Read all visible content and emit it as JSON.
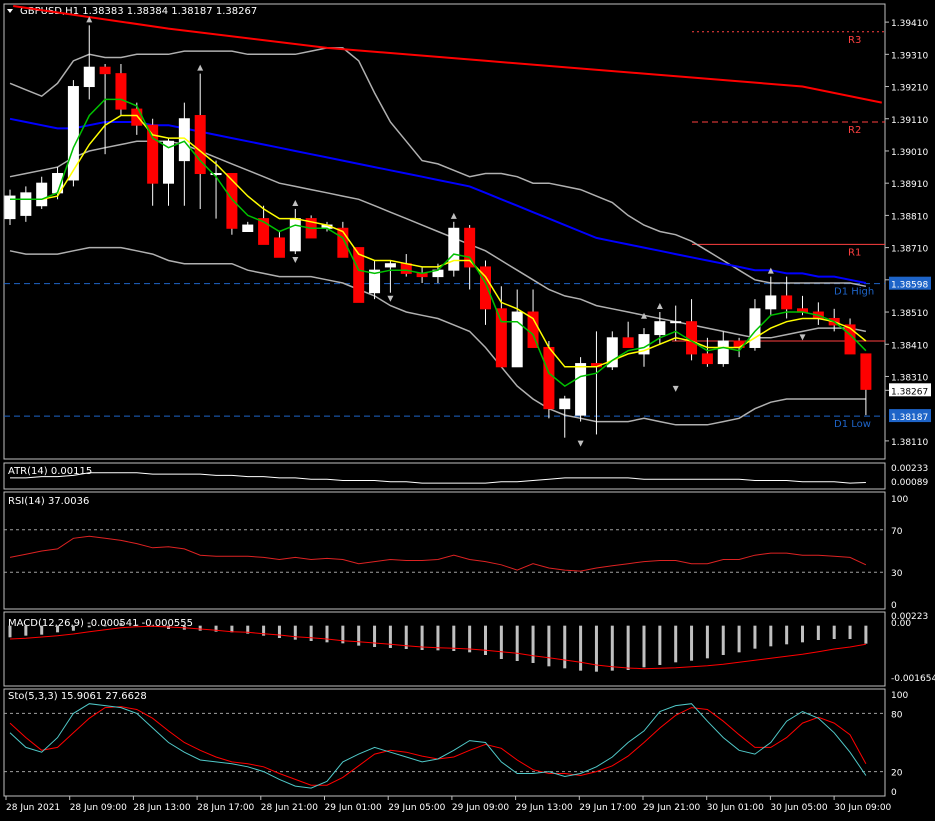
{
  "colors": {
    "background": "#000000",
    "bull_body": "#ffffff",
    "bear_body": "#ff0000",
    "wick": "#ffffff",
    "grid": "#808080",
    "bands": "#b0b0b0",
    "ma_fast": "#00c000",
    "ma_slow": "#ffff00",
    "ma_blue": "#0000ff",
    "ma_red": "#ff0000",
    "pivot": "#ff4040",
    "day_levels": "#1e64c8",
    "price_label_bg": "#1e64c8",
    "macd_hist": "#c0c0c0",
    "macd_signal": "#ff0000",
    "rsi_line": "#dd2222",
    "sto_main": "#50c8c8",
    "sto_signal": "#ff0000"
  },
  "chart_data": [
    {
      "type": "candlestick",
      "title": "GBPUSD,H1  1.38383 1.38384 1.38187 1.38267",
      "symbol": "GBPUSD",
      "timeframe": "H1",
      "ohlc_header": "1.38383 1.38384 1.38187 1.38267",
      "last_price_label": "1.38267",
      "ylim": [
        1.3806,
        1.3946
      ],
      "yticks": [
        "1.39410",
        "1.39310",
        "1.39210",
        "1.39110",
        "1.39010",
        "1.38910",
        "1.38810",
        "1.38710",
        "1.38610",
        "1.38510",
        "1.38410",
        "1.38310",
        "1.38267",
        "1.38110"
      ],
      "xtick_labels": [
        "28 Jun 2021",
        "28 Jun 09:00",
        "28 Jun 13:00",
        "28 Jun 17:00",
        "28 Jun 21:00",
        "29 Jun 01:00",
        "29 Jun 05:00",
        "29 Jun 09:00",
        "29 Jun 13:00",
        "29 Jun 17:00",
        "29 Jun 21:00",
        "30 Jun 01:00",
        "30 Jun 05:00",
        "30 Jun 09:00"
      ],
      "candles": [
        [
          1.388,
          1.3889,
          1.3878,
          1.3887
        ],
        [
          1.3881,
          1.389,
          1.3879,
          1.3888
        ],
        [
          1.3884,
          1.3893,
          1.3883,
          1.3891
        ],
        [
          1.3888,
          1.3896,
          1.3886,
          1.3894
        ],
        [
          1.3892,
          1.3923,
          1.389,
          1.3921
        ],
        [
          1.3921,
          1.394,
          1.3917,
          1.3927
        ],
        [
          1.3927,
          1.3928,
          1.39,
          1.3925
        ],
        [
          1.3925,
          1.3928,
          1.3912,
          1.3914
        ],
        [
          1.3914,
          1.3916,
          1.3906,
          1.3909
        ],
        [
          1.3909,
          1.3911,
          1.3884,
          1.3891
        ],
        [
          1.3891,
          1.3905,
          1.3884,
          1.3904
        ],
        [
          1.3898,
          1.3916,
          1.3884,
          1.3911
        ],
        [
          1.3912,
          1.3925,
          1.3883,
          1.3894
        ],
        [
          1.3894,
          1.3898,
          1.388,
          1.3894
        ],
        [
          1.3894,
          1.3894,
          1.3875,
          1.3877
        ],
        [
          1.3876,
          1.3879,
          1.3876,
          1.3878
        ],
        [
          1.388,
          1.3884,
          1.3872,
          1.3872
        ],
        [
          1.3874,
          1.3876,
          1.3868,
          1.3868
        ],
        [
          1.387,
          1.3883,
          1.3869,
          1.388
        ],
        [
          1.388,
          1.3881,
          1.3874,
          1.3874
        ],
        [
          1.3877,
          1.3879,
          1.3876,
          1.3878
        ],
        [
          1.3877,
          1.3879,
          1.3868,
          1.3868
        ],
        [
          1.3871,
          1.3871,
          1.3854,
          1.3854
        ],
        [
          1.3857,
          1.3867,
          1.3855,
          1.3864
        ],
        [
          1.3865,
          1.3867,
          1.3857,
          1.3866
        ],
        [
          1.3866,
          1.3869,
          1.3862,
          1.3863
        ],
        [
          1.3863,
          1.3865,
          1.386,
          1.3862
        ],
        [
          1.3862,
          1.3866,
          1.386,
          1.3864
        ],
        [
          1.3864,
          1.3879,
          1.3862,
          1.3877
        ],
        [
          1.3877,
          1.3878,
          1.3858,
          1.3865
        ],
        [
          1.3865,
          1.3867,
          1.3847,
          1.3852
        ],
        [
          1.3852,
          1.3859,
          1.3834,
          1.3834
        ],
        [
          1.3834,
          1.3858,
          1.3834,
          1.3851
        ],
        [
          1.3851,
          1.3858,
          1.384,
          1.384
        ],
        [
          1.384,
          1.3842,
          1.3818,
          1.3821
        ],
        [
          1.3821,
          1.3825,
          1.3812,
          1.3824
        ],
        [
          1.3819,
          1.3837,
          1.3817,
          1.3835
        ],
        [
          1.3835,
          1.3845,
          1.3813,
          1.3834
        ],
        [
          1.3834,
          1.3845,
          1.3833,
          1.3843
        ],
        [
          1.3843,
          1.3848,
          1.384,
          1.384
        ],
        [
          1.3838,
          1.3846,
          1.3834,
          1.3844
        ],
        [
          1.3844,
          1.3851,
          1.3841,
          1.3848
        ],
        [
          1.3848,
          1.3853,
          1.3842,
          1.3848
        ],
        [
          1.3848,
          1.3855,
          1.3836,
          1.3838
        ],
        [
          1.3838,
          1.3843,
          1.3834,
          1.3835
        ],
        [
          1.3835,
          1.3845,
          1.3834,
          1.3842
        ],
        [
          1.3842,
          1.3843,
          1.3837,
          1.384
        ],
        [
          1.384,
          1.3855,
          1.3839,
          1.3852
        ],
        [
          1.3852,
          1.3862,
          1.385,
          1.3856
        ],
        [
          1.3856,
          1.3862,
          1.3849,
          1.3852
        ],
        [
          1.3852,
          1.3856,
          1.385,
          1.3851
        ],
        [
          1.3851,
          1.3854,
          1.3847,
          1.3849
        ],
        [
          1.3849,
          1.3852,
          1.3845,
          1.3847
        ],
        [
          1.3847,
          1.3849,
          1.3838,
          1.3838
        ],
        [
          1.3838,
          1.3838,
          1.3819,
          1.3827
        ]
      ],
      "ma_fast": [
        1.3886,
        1.3886,
        1.3886,
        1.3888,
        1.3902,
        1.3912,
        1.3917,
        1.3917,
        1.3915,
        1.3905,
        1.3902,
        1.3904,
        1.3898,
        1.3893,
        1.3886,
        1.3881,
        1.3879,
        1.3876,
        1.3878,
        1.3877,
        1.3877,
        1.3874,
        1.3864,
        1.3863,
        1.3864,
        1.3864,
        1.3863,
        1.3864,
        1.3869,
        1.3868,
        1.386,
        1.3848,
        1.3848,
        1.3844,
        1.3832,
        1.3828,
        1.3831,
        1.3832,
        1.3836,
        1.3839,
        1.384,
        1.3843,
        1.3845,
        1.3842,
        1.3839,
        1.384,
        1.3839,
        1.3845,
        1.385,
        1.3851,
        1.3851,
        1.385,
        1.3848,
        1.3844,
        1.3839
      ],
      "ma_slow": [
        1.3886,
        1.3886,
        1.3886,
        1.3887,
        1.3895,
        1.3903,
        1.3909,
        1.3912,
        1.3912,
        1.3906,
        1.3905,
        1.3905,
        1.3901,
        1.3897,
        1.3892,
        1.3887,
        1.3883,
        1.388,
        1.388,
        1.3879,
        1.3878,
        1.3876,
        1.3869,
        1.3867,
        1.3867,
        1.3866,
        1.3865,
        1.3865,
        1.3867,
        1.3867,
        1.3862,
        1.3854,
        1.3852,
        1.3849,
        1.384,
        1.3834,
        1.3834,
        1.3834,
        1.3836,
        1.3838,
        1.3839,
        1.3841,
        1.3843,
        1.3842,
        1.384,
        1.384,
        1.384,
        1.3843,
        1.3846,
        1.3848,
        1.3849,
        1.3849,
        1.3848,
        1.3846,
        1.3842
      ],
      "ma_blue": [
        1.3911,
        1.391,
        1.3909,
        1.3908,
        1.3908,
        1.3909,
        1.391,
        1.391,
        1.391,
        1.3909,
        1.3909,
        1.3908,
        1.3907,
        1.3906,
        1.3905,
        1.3904,
        1.3903,
        1.3902,
        1.3901,
        1.39,
        1.3899,
        1.3898,
        1.3897,
        1.3896,
        1.3895,
        1.3894,
        1.3893,
        1.3892,
        1.3891,
        1.389,
        1.3888,
        1.3886,
        1.3884,
        1.3882,
        1.388,
        1.3878,
        1.3876,
        1.3874,
        1.3873,
        1.3872,
        1.3871,
        1.387,
        1.3869,
        1.3868,
        1.3867,
        1.3866,
        1.3865,
        1.3864,
        1.3864,
        1.3863,
        1.3863,
        1.3862,
        1.3862,
        1.3861,
        1.386
      ],
      "ma_red": [
        [
          0.2,
          1.3946
        ],
        [
          10,
          1.3939
        ],
        [
          20,
          1.3933
        ],
        [
          30,
          1.3929
        ],
        [
          40,
          1.3925
        ],
        [
          50,
          1.3921
        ],
        [
          55,
          1.3916
        ]
      ],
      "bb_upper": [
        1.3922,
        1.392,
        1.3918,
        1.3922,
        1.3929,
        1.3931,
        1.393,
        1.393,
        1.3931,
        1.3931,
        1.3931,
        1.3932,
        1.3932,
        1.3932,
        1.3932,
        1.3931,
        1.3931,
        1.3931,
        1.3931,
        1.3932,
        1.3933,
        1.3933,
        1.3929,
        1.3919,
        1.391,
        1.3904,
        1.3898,
        1.3897,
        1.3895,
        1.3893,
        1.3894,
        1.3894,
        1.3893,
        1.3891,
        1.3891,
        1.389,
        1.3889,
        1.3887,
        1.3885,
        1.3881,
        1.3878,
        1.3876,
        1.3875,
        1.3873,
        1.387,
        1.3867,
        1.3864,
        1.3861,
        1.386,
        1.386,
        1.386,
        1.386,
        1.386,
        1.386,
        1.3859
      ],
      "bb_mid": [
        1.3893,
        1.3894,
        1.3895,
        1.3896,
        1.3899,
        1.3901,
        1.3902,
        1.3903,
        1.3904,
        1.3904,
        1.3904,
        1.3903,
        1.3901,
        1.3899,
        1.3897,
        1.3895,
        1.3893,
        1.3891,
        1.389,
        1.3889,
        1.3888,
        1.3887,
        1.3886,
        1.3884,
        1.3882,
        1.388,
        1.3878,
        1.3876,
        1.3874,
        1.3872,
        1.387,
        1.3867,
        1.3864,
        1.3861,
        1.3858,
        1.3856,
        1.3855,
        1.3853,
        1.3852,
        1.3851,
        1.385,
        1.3849,
        1.3848,
        1.3847,
        1.3846,
        1.3845,
        1.3844,
        1.3843,
        1.3843,
        1.3844,
        1.3845,
        1.3846,
        1.3846,
        1.3846,
        1.3845
      ],
      "bb_lower": [
        1.387,
        1.3869,
        1.3869,
        1.3869,
        1.387,
        1.3871,
        1.3871,
        1.3871,
        1.387,
        1.3869,
        1.3867,
        1.3866,
        1.3866,
        1.3866,
        1.3866,
        1.3864,
        1.3863,
        1.3862,
        1.3862,
        1.3862,
        1.3861,
        1.386,
        1.3858,
        1.3856,
        1.3853,
        1.3851,
        1.385,
        1.3849,
        1.3847,
        1.3845,
        1.384,
        1.3834,
        1.3828,
        1.3824,
        1.3821,
        1.3819,
        1.3818,
        1.3817,
        1.3817,
        1.3817,
        1.3818,
        1.3817,
        1.3816,
        1.3816,
        1.3816,
        1.3817,
        1.3818,
        1.3821,
        1.3823,
        1.3824,
        1.3824,
        1.3824,
        1.3824,
        1.3824,
        1.3824
      ],
      "fractals_up": [
        [
          5,
          1.394
        ],
        [
          12,
          1.3925
        ],
        [
          18,
          1.3883
        ],
        [
          28,
          1.3879
        ],
        [
          48,
          1.3862
        ],
        [
          40,
          1.3848
        ],
        [
          41,
          1.3851
        ]
      ],
      "fractals_down": [
        [
          18,
          1.3869
        ],
        [
          24,
          1.3857
        ],
        [
          36,
          1.3812
        ],
        [
          42,
          1.3829
        ],
        [
          50,
          1.3845
        ]
      ],
      "levels": [
        {
          "name": "R3",
          "value": 1.3938,
          "style": "dotted"
        },
        {
          "name": "R2",
          "value": 1.391,
          "style": "dashed"
        },
        {
          "name": "R1",
          "value": 1.3872,
          "style": "solid"
        },
        {
          "name": "P",
          "value": 1.3842,
          "style": "solid"
        },
        {
          "name": "D1 High",
          "value": 1.38598,
          "style": "dashed",
          "price_label": "1.38598"
        },
        {
          "name": "D1 Low",
          "value": 1.38187,
          "style": "dashed",
          "price_label": "1.38187"
        }
      ]
    },
    {
      "type": "line",
      "title": "ATR(14) 0.00115",
      "yticks": [
        "0.00233",
        "0.00089"
      ],
      "ylim": [
        0.0008,
        0.0025
      ],
      "values": [
        0.0015,
        0.0015,
        0.0016,
        0.0016,
        0.0017,
        0.0019,
        0.0019,
        0.0019,
        0.0019,
        0.0018,
        0.0018,
        0.0018,
        0.0018,
        0.0017,
        0.0017,
        0.0016,
        0.0016,
        0.0015,
        0.0015,
        0.0014,
        0.0014,
        0.0013,
        0.0013,
        0.0013,
        0.0012,
        0.0012,
        0.0011,
        0.0011,
        0.0011,
        0.0011,
        0.0011,
        0.0012,
        0.0012,
        0.0013,
        0.0014,
        0.0015,
        0.0015,
        0.0015,
        0.0015,
        0.0015,
        0.0014,
        0.0014,
        0.0014,
        0.0014,
        0.0014,
        0.0014,
        0.0014,
        0.0013,
        0.0013,
        0.0013,
        0.0012,
        0.0012,
        0.0012,
        0.0011,
        0.00115
      ]
    },
    {
      "type": "line",
      "title": "RSI(14) 37.0036",
      "ylim": [
        0,
        100
      ],
      "yticks": [
        "100",
        "70",
        "30",
        "0"
      ],
      "levels": [
        70,
        30
      ],
      "values": [
        44,
        47,
        50,
        52,
        62,
        64,
        62,
        60,
        57,
        53,
        54,
        52,
        46,
        45,
        45,
        45,
        44,
        42,
        44,
        42,
        43,
        42,
        38,
        40,
        42,
        41,
        41,
        42,
        46,
        42,
        40,
        37,
        32,
        38,
        34,
        32,
        31,
        34,
        36,
        38,
        40,
        41,
        41,
        38,
        38,
        42,
        42,
        46,
        48,
        48,
        46,
        46,
        45,
        44,
        37
      ]
    },
    {
      "type": "bar",
      "title": "MACD(12,26,9) -0.000541 -0.000555",
      "ylim": [
        -0.00175,
        0.00035
      ],
      "yticks": [
        "0.00223",
        "0.00",
        "-0.001654"
      ],
      "values": [
        -0.00035,
        -0.0003,
        -0.00027,
        -0.0002,
        -0.00015,
        -5e-05,
        1e-05,
        8e-05,
        3e-05,
        -2e-05,
        -0.0001,
        -0.00012,
        -0.00015,
        -0.00018,
        -0.0002,
        -0.00024,
        -0.0003,
        -0.00037,
        -0.00042,
        -0.00046,
        -0.0005,
        -0.00053,
        -0.0006,
        -0.00064,
        -0.00067,
        -0.0007,
        -0.00073,
        -0.00074,
        -0.00076,
        -0.0008,
        -0.00088,
        -0.001,
        -0.00106,
        -0.00112,
        -0.00122,
        -0.00128,
        -0.00135,
        -0.00138,
        -0.00135,
        -0.00133,
        -0.00125,
        -0.00118,
        -0.0011,
        -0.00105,
        -0.00098,
        -0.00088,
        -0.0008,
        -0.00069,
        -0.00062,
        -0.00056,
        -0.0005,
        -0.00043,
        -0.0004,
        -0.0004,
        -0.00054
      ],
      "signal": [
        -0.0004,
        -0.00038,
        -0.00034,
        -0.0003,
        -0.00025,
        -0.00018,
        -0.00012,
        -6e-05,
        -3e-05,
        -2e-05,
        -4e-05,
        -6e-05,
        -0.0001,
        -0.00014,
        -0.00018,
        -0.0002,
        -0.00024,
        -0.00028,
        -0.00033,
        -0.00036,
        -0.0004,
        -0.00045,
        -0.00048,
        -0.00052,
        -0.00056,
        -0.0006,
        -0.00064,
        -0.00066,
        -0.00068,
        -0.0007,
        -0.00074,
        -0.00078,
        -0.00083,
        -0.0009,
        -0.00096,
        -0.00103,
        -0.0011,
        -0.00118,
        -0.00123,
        -0.00127,
        -0.00129,
        -0.00128,
        -0.00126,
        -0.00123,
        -0.0012,
        -0.00116,
        -0.0011,
        -0.00104,
        -0.00098,
        -0.00092,
        -0.00086,
        -0.00078,
        -0.0007,
        -0.00064,
        -0.00056
      ]
    },
    {
      "type": "line",
      "title": "Sto(5,3,3) 15.9061 27.6628",
      "ylim": [
        0,
        100
      ],
      "yticks": [
        "100",
        "80",
        "20",
        "0"
      ],
      "levels": [
        80,
        20
      ],
      "main": [
        60,
        45,
        40,
        55,
        80,
        90,
        88,
        86,
        80,
        65,
        50,
        40,
        32,
        30,
        28,
        25,
        20,
        12,
        5,
        3,
        10,
        30,
        38,
        45,
        40,
        35,
        30,
        33,
        42,
        52,
        50,
        30,
        18,
        18,
        20,
        15,
        18,
        25,
        35,
        50,
        62,
        82,
        88,
        90,
        72,
        55,
        42,
        38,
        50,
        72,
        82,
        75,
        60,
        40,
        16
      ],
      "signal": [
        70,
        55,
        42,
        45,
        60,
        75,
        86,
        87,
        84,
        75,
        62,
        50,
        42,
        35,
        30,
        28,
        25,
        18,
        12,
        6,
        6,
        14,
        26,
        38,
        42,
        40,
        36,
        33,
        35,
        42,
        48,
        44,
        32,
        22,
        18,
        18,
        16,
        20,
        26,
        36,
        50,
        65,
        78,
        86,
        84,
        72,
        58,
        45,
        45,
        55,
        70,
        76,
        70,
        58,
        28
      ]
    }
  ]
}
